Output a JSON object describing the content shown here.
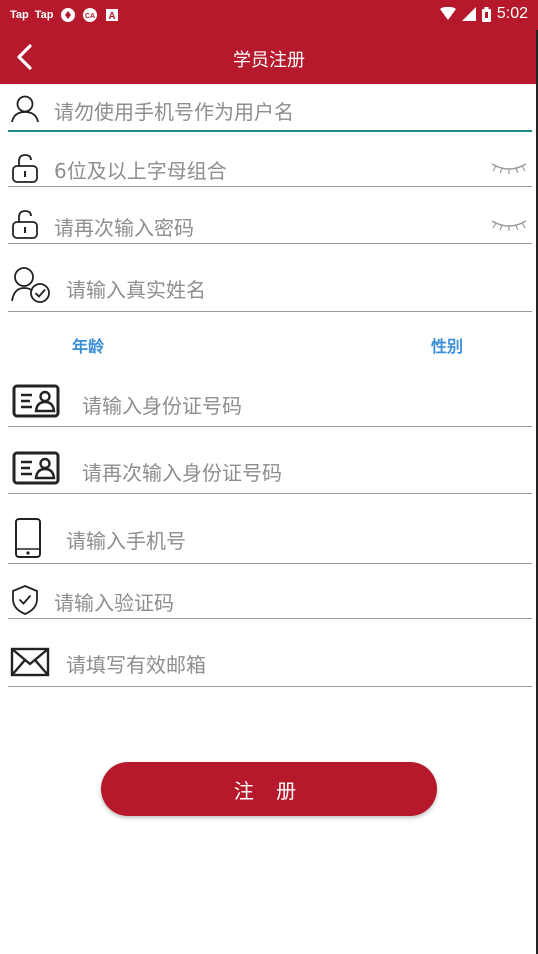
{
  "status_bar": {
    "app_labels": [
      "Tap",
      "Tap"
    ],
    "time": "5:02",
    "icons": [
      "tap-icon",
      "tap-icon",
      "vpn-icon",
      "infinity-icon",
      "a-icon",
      "wifi-icon",
      "signal-icon",
      "battery-icon"
    ]
  },
  "header": {
    "title": "学员注册",
    "back_icon": "chevron-left-icon"
  },
  "form": {
    "username": {
      "placeholder": "请勿使用手机号作为用户名",
      "icon": "user-icon"
    },
    "password": {
      "placeholder": "6位及以上字母组合",
      "icon": "lock-icon",
      "toggle_icon": "eye-closed-icon"
    },
    "confirm_password": {
      "placeholder": "请再次输入密码",
      "icon": "lock-icon",
      "toggle_icon": "eye-closed-icon"
    },
    "real_name": {
      "placeholder": "请输入真实姓名",
      "icon": "user-check-icon"
    },
    "age_label": "年龄",
    "gender_label": "性别",
    "id_number": {
      "placeholder": "请输入身份证号码",
      "icon": "id-card-icon"
    },
    "confirm_id_number": {
      "placeholder": "请再次输入身份证号码",
      "icon": "id-card-icon"
    },
    "phone": {
      "placeholder": "请输入手机号",
      "icon": "phone-icon"
    },
    "verify_code": {
      "placeholder": "请输入验证码",
      "icon": "shield-check-icon"
    },
    "email": {
      "placeholder": "请填写有效邮箱",
      "icon": "mail-icon"
    }
  },
  "submit_label": "注 册",
  "colors": {
    "brand": "#b5192b",
    "active_line": "#1f8a82",
    "label_blue": "#3a8fd8"
  }
}
